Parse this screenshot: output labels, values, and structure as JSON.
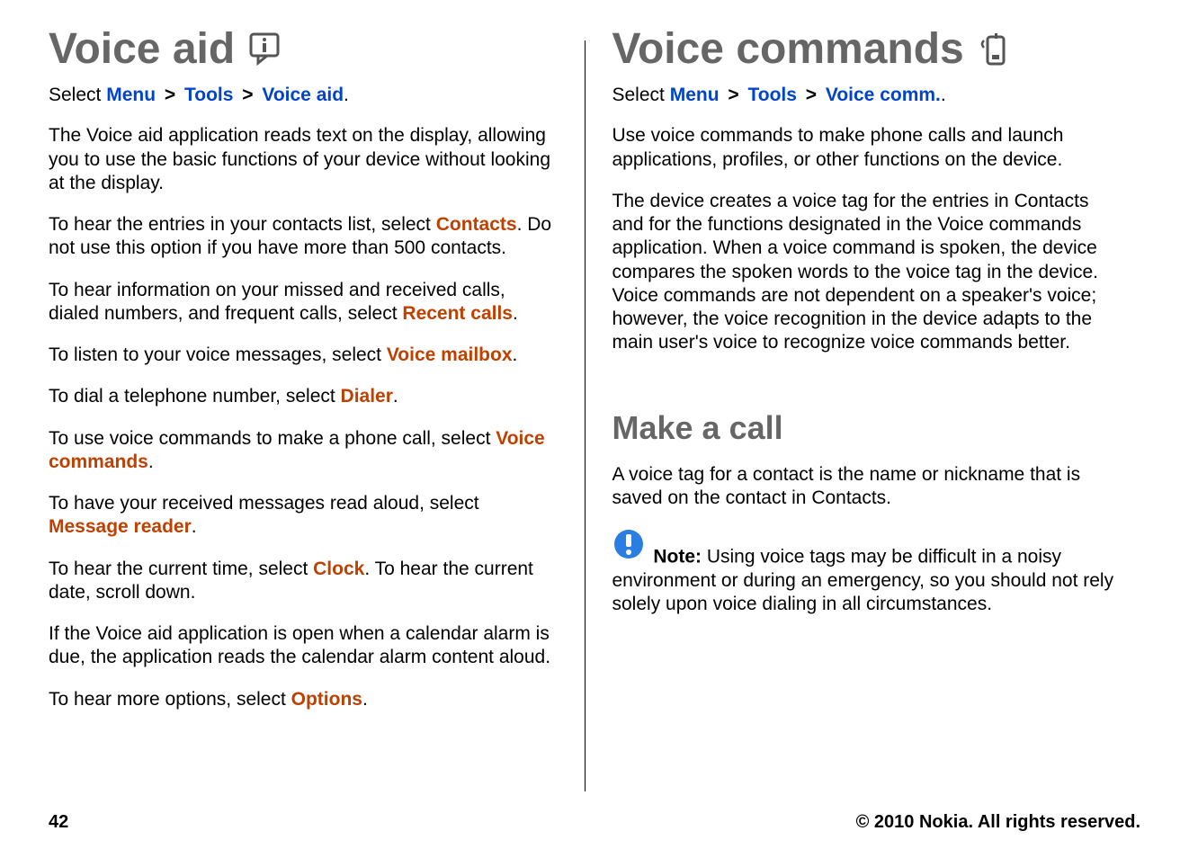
{
  "left": {
    "title": "Voice aid",
    "breadcrumb": {
      "prefix": "Select ",
      "items": [
        "Menu",
        "Tools",
        "Voice aid"
      ],
      "sep": ">",
      "suffix": "."
    },
    "p_intro": "The Voice aid application reads text on the display, allowing you to use the basic functions of your device without looking at the display.",
    "p_contacts_pre": "To hear the entries in your contacts list, select ",
    "link_contacts": "Contacts",
    "p_contacts_post": ". Do not use this option if you have more than 500 contacts.",
    "p_recent_pre": "To hear information on your missed and received calls, dialed numbers, and frequent calls, select ",
    "link_recent": "Recent calls",
    "p_recent_post": ".",
    "p_vm_pre": "To listen to your voice messages, select ",
    "link_vm": "Voice mailbox",
    "p_vm_post": ".",
    "p_dialer_pre": "To dial a telephone number, select ",
    "link_dialer": "Dialer",
    "p_dialer_post": ".",
    "p_vc_pre": "To use voice commands to make a phone call, select ",
    "link_vc": "Voice commands",
    "p_vc_post": ".",
    "p_mr_pre": "To have your received messages read aloud, select ",
    "link_mr": "Message reader",
    "p_mr_post": ".",
    "p_clock_pre": "To hear the current time, select ",
    "link_clock": "Clock",
    "p_clock_post": ". To hear the current date, scroll down.",
    "p_calendar": "If the Voice aid application is open when a calendar alarm is due, the application reads the calendar alarm content aloud.",
    "p_options_pre": "To hear more options, select ",
    "link_options": "Options",
    "p_options_post": "."
  },
  "right": {
    "title": "Voice commands",
    "breadcrumb": {
      "prefix": "Select ",
      "items": [
        "Menu",
        "Tools",
        "Voice comm."
      ],
      "sep": ">",
      "suffix": "."
    },
    "p_intro": "Use voice commands to make phone calls and launch applications, profiles, or other functions on the device.",
    "p_desc": "The device creates a voice tag for the entries in Contacts and for the functions designated in the Voice commands application. When a voice command is spoken, the device compares the spoken words to the voice tag in the device. Voice commands are not dependent on a speaker's voice; however, the voice recognition in the device adapts to the main user's voice to recognize voice commands better.",
    "sub_title": "Make a call",
    "p_sub_intro": "A voice tag for a contact is the name or nickname that is saved on the contact in Contacts.",
    "note_label": "Note:",
    "note_text": "  Using voice tags may be difficult in a noisy environment or during an emergency, so you should not rely solely upon voice dialing in all circumstances."
  },
  "footer": {
    "page": "42",
    "copyright": "© 2010 Nokia. All rights reserved."
  }
}
